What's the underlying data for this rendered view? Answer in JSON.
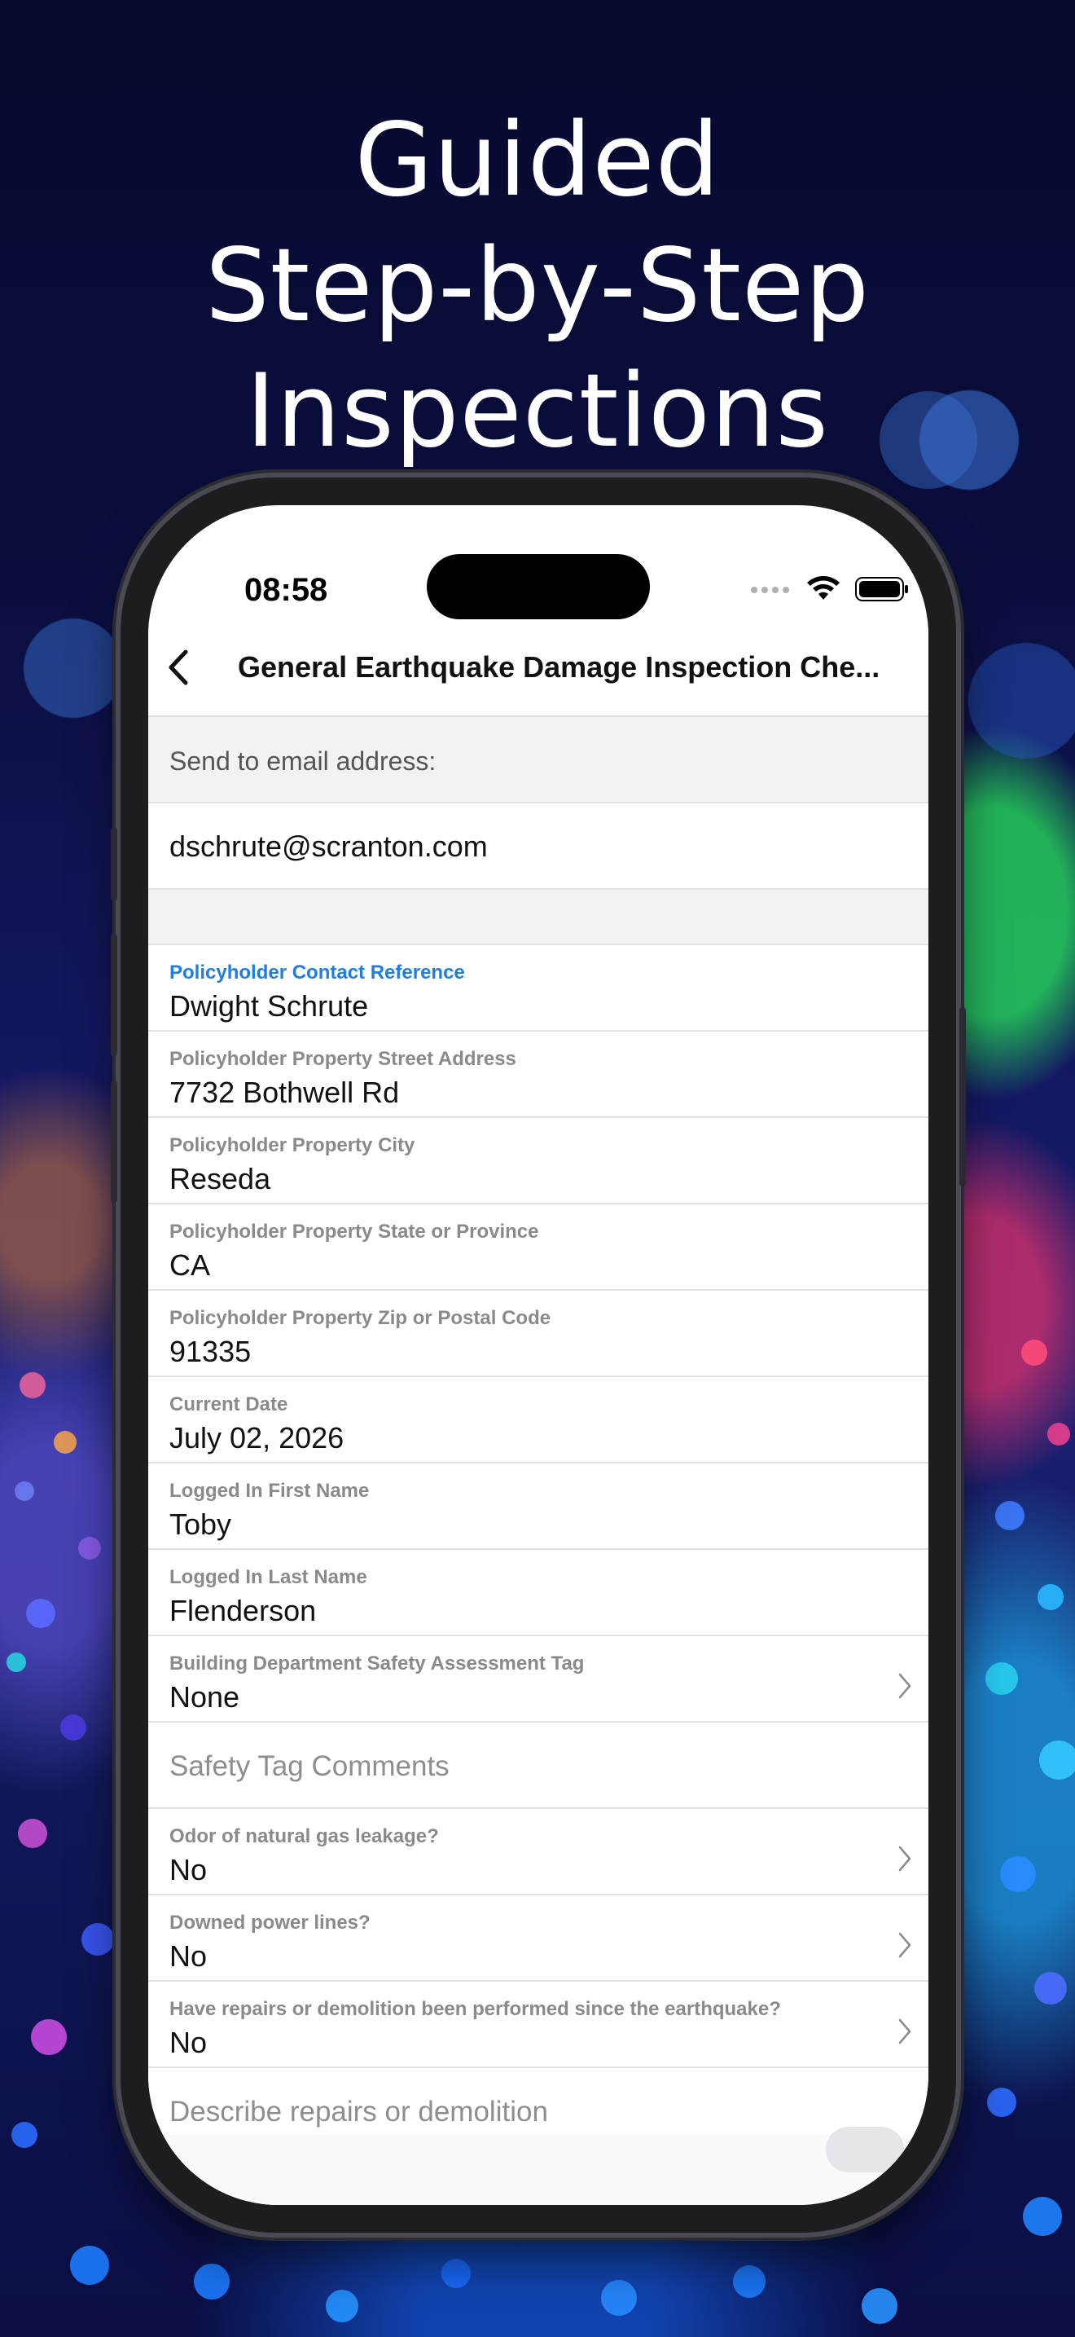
{
  "headline": [
    "Guided",
    "Step-by-Step",
    "Inspections"
  ],
  "status_bar": {
    "time": "08:58"
  },
  "nav": {
    "title": "General Earthquake Damage Inspection Che..."
  },
  "email": {
    "label": "Send to email address:",
    "value": "dschrute@scranton.com"
  },
  "fields": [
    {
      "label": "Policyholder Contact Reference",
      "value": "Dwight Schrute",
      "active": true
    },
    {
      "label": "Policyholder Property Street Address",
      "value": "7732 Bothwell Rd"
    },
    {
      "label": "Policyholder Property City",
      "value": "Reseda"
    },
    {
      "label": "Policyholder Property State or Province",
      "value": "CA"
    },
    {
      "label": "Policyholder Property Zip or Postal Code",
      "value": "91335"
    },
    {
      "label": "Current Date",
      "value": "July 02, 2026"
    },
    {
      "label": "Logged In First Name",
      "value": "Toby"
    },
    {
      "label": "Logged In Last Name",
      "value": "Flenderson"
    },
    {
      "label": "Building Department Safety Assessment Tag",
      "value": "None"
    }
  ],
  "safety_tag_comments": "Safety Tag Comments",
  "questions": [
    {
      "label": "Odor of natural gas leakage?",
      "value": "No"
    },
    {
      "label": "Downed power lines?",
      "value": "No"
    },
    {
      "label": "Have repairs or demolition been performed since the earthquake?",
      "value": "No"
    }
  ],
  "describe_repairs": "Describe repairs or demolition",
  "colors": {
    "accent_blue": "#1f7ee6",
    "label_gray": "#8a8a8e",
    "background_navy": "#0a0e3e"
  }
}
